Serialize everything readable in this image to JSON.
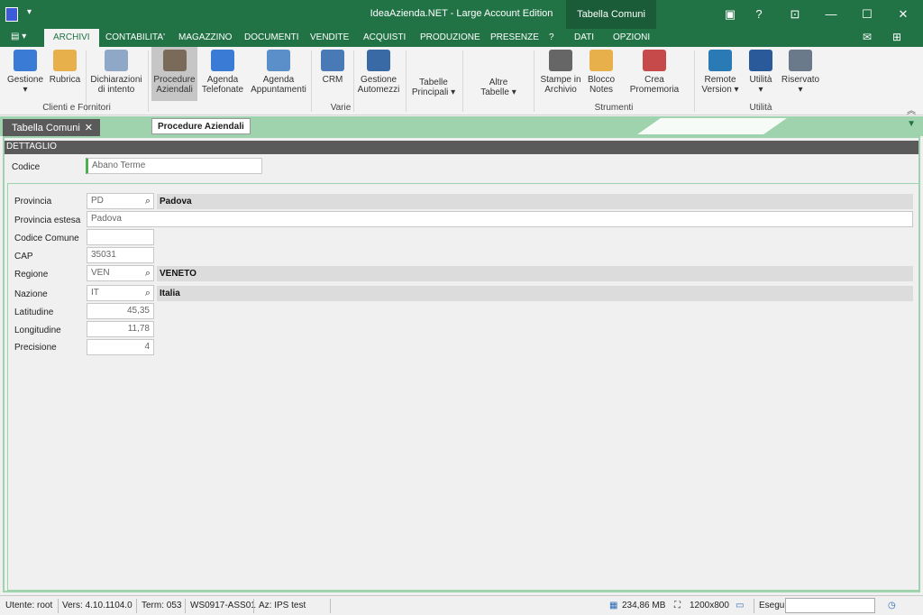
{
  "titlebar": {
    "title": "IdeaAzienda.NET - Large Account Edition",
    "context_tab": "Tabella Comuni",
    "help": "?"
  },
  "ribbon_tabs": [
    "ARCHIVI",
    "CONTABILITA'",
    "MAGAZZINO",
    "DOCUMENTI",
    "VENDITE",
    "ACQUISTI",
    "PRODUZIONE",
    "PRESENZE",
    "?",
    "DATI",
    "OPZIONI"
  ],
  "ribbon": {
    "buttons": [
      {
        "label1": "Gestione",
        "label2": "▾",
        "color": "#3a7bd5"
      },
      {
        "label1": "Rubrica",
        "label2": "",
        "color": "#e8b04a"
      },
      {
        "label1": "Dichiarazioni",
        "label2": "di intento",
        "color": "#8fa8c8"
      },
      {
        "label1": "Procedure",
        "label2": "Aziendali",
        "color": "#7a6a5a"
      },
      {
        "label1": "Agenda",
        "label2": "Telefonate",
        "color": "#3a7bd5"
      },
      {
        "label1": "Agenda",
        "label2": "Appuntamenti",
        "color": "#5b8fc9"
      },
      {
        "label1": "CRM",
        "label2": "",
        "color": "#4a7ab5"
      },
      {
        "label1": "Gestione",
        "label2": "Automezzi",
        "color": "#3a6aa5"
      },
      {
        "label1": "Tabelle",
        "label2": "Principali ▾",
        "color": ""
      },
      {
        "label1": "Altre",
        "label2": "Tabelle ▾",
        "color": ""
      },
      {
        "label1": "Stampe in",
        "label2": "Archivio",
        "color": "#666"
      },
      {
        "label1": "Blocco",
        "label2": "Notes",
        "color": "#e8b04a"
      },
      {
        "label1": "Crea Promemoria",
        "label2": "",
        "color": "#c74a4a"
      },
      {
        "label1": "Remote",
        "label2": "Version ▾",
        "color": "#2a7ab5"
      },
      {
        "label1": "Utilità",
        "label2": "▾",
        "color": "#2a5a9a"
      },
      {
        "label1": "Riservato",
        "label2": "▾",
        "color": "#6a7a8a"
      }
    ],
    "groups": [
      "Clienti e Fornitori",
      "Varie",
      "Strumenti",
      "Utilità"
    ]
  },
  "doctab": {
    "label": "Tabella Comuni",
    "close": "✕",
    "tooltip": "Procedure Aziendali"
  },
  "detail": {
    "section": "DETTAGLIO",
    "codice_label": "Codice",
    "codice_value": "Abano Terme",
    "fields": {
      "provincia": {
        "label": "Provincia",
        "value": "PD",
        "desc": "Padova"
      },
      "provincia_estesa": {
        "label": "Provincia estesa",
        "value": "Padova"
      },
      "codice_comune": {
        "label": "Codice Comune",
        "value": ""
      },
      "cap": {
        "label": "CAP",
        "value": "35031"
      },
      "regione": {
        "label": "Regione",
        "value": "VEN",
        "desc": "VENETO"
      },
      "nazione": {
        "label": "Nazione",
        "value": "IT",
        "desc": "Italia"
      },
      "latitudine": {
        "label": "Latitudine",
        "value": "45,35"
      },
      "longitudine": {
        "label": "Longitudine",
        "value": "11,78"
      },
      "precisione": {
        "label": "Precisione",
        "value": "4"
      }
    }
  },
  "status": {
    "utente": "Utente: root",
    "vers": "Vers: 4.10.1104.0",
    "term": "Term: 053",
    "ws": "WS0917-ASS01",
    "az": "Az: IPS test",
    "mem": "234,86 MB",
    "res": "1200x800",
    "esegui": "Esegui"
  }
}
